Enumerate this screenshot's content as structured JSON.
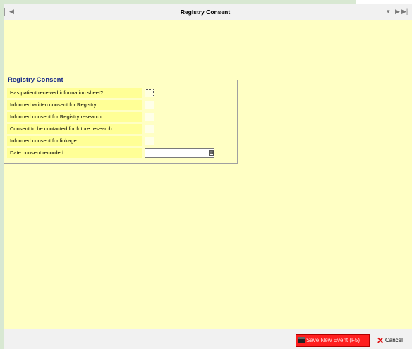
{
  "header": {
    "title": "Registry Consent",
    "nav_prev_glyph": "◀",
    "nav_down_glyph": "▾",
    "nav_next_glyph": "▶",
    "nav_last_glyph": "▶|"
  },
  "group": {
    "title": "Registry Consent",
    "fields": [
      {
        "label": "Has patient received information sheet?",
        "type": "checkbox",
        "checked": false
      },
      {
        "label": "Informed written consent for Registry",
        "type": "checkbox",
        "checked": false
      },
      {
        "label": "Informed consent for Registry research",
        "type": "checkbox",
        "checked": false
      },
      {
        "label": "Consent to be contacted for future research",
        "type": "checkbox",
        "checked": false
      },
      {
        "label": "Informed consent for linkage",
        "type": "checkbox",
        "checked": false
      },
      {
        "label": "Date consent recorded",
        "type": "date",
        "value": ""
      }
    ]
  },
  "footer": {
    "save_label": "Save New Event (F5)",
    "cancel_label": "Cancel"
  },
  "colors": {
    "content_bg": "#ffffc4",
    "label_bg": "#ffff96",
    "group_title": "#1a2c8a",
    "save_button_bg": "#ff1e1e"
  }
}
